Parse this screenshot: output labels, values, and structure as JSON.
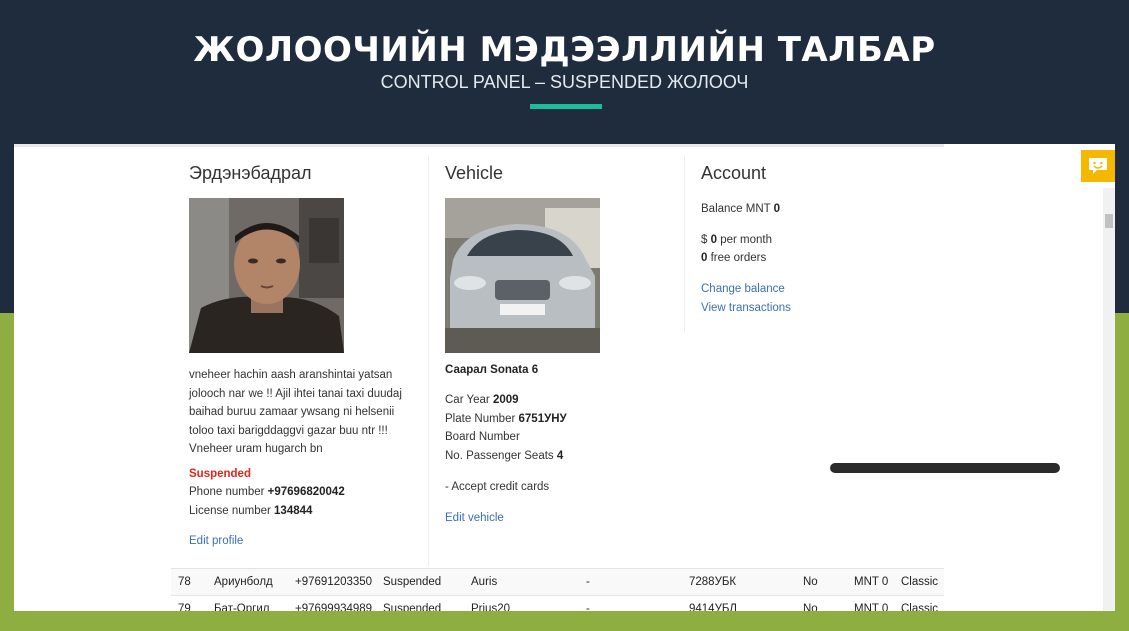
{
  "hero": {
    "title": "ЖОЛООЧИЙН МЭДЭЭЛЛИЙН ТАЛБАР",
    "subtitle": "CONTROL PANEL – SUSPENDED ЖОЛООЧ",
    "accent_color": "#1abc9c"
  },
  "driver": {
    "name": "Эрдэнэбадрал",
    "bio_lines": [
      "vneheer hachin aash aranshintai yatsan",
      "jolooch nar we !! Ajil ihtei tanai taxi duudaj",
      "baihad buruu zamaar ywsang ni helsenii",
      "toloo taxi barigddaggvi gazar buu ntr !!!",
      "Vneheer uram hugarch bn"
    ],
    "status": "Suspended",
    "phone_label": "Phone number",
    "phone": "+97696820042",
    "license_label": "License number",
    "license": "134844",
    "edit_link": "Edit profile"
  },
  "vehicle": {
    "heading": "Vehicle",
    "name": "Саарал Sonata 6",
    "year_label": "Car Year",
    "year": "2009",
    "plate_label": "Plate Number",
    "plate": "6751УНУ",
    "board_label": "Board Number",
    "seats_label": "No. Passenger Seats",
    "seats": "4",
    "credit": "- Accept credit cards",
    "plate_on_car": "6751 УНУ",
    "edit_link": "Edit vehicle"
  },
  "account": {
    "heading": "Account",
    "balance_label": "Balance MNT",
    "balance": "0",
    "rate_prefix": "$",
    "rate": "0",
    "rate_suffix": "per month",
    "free_orders": "0",
    "free_label": "free orders",
    "change_balance": "Change balance",
    "view_transactions": "View transactions"
  },
  "table_rows": [
    {
      "id": "78",
      "name": "Ариунболд",
      "phone": "+97691203350",
      "status": "Suspended",
      "model": "Auris",
      "dash": "-",
      "plate": "7288УБК",
      "credit": "No",
      "balance": "MNT 0",
      "class": "Classic"
    },
    {
      "id": "79",
      "name": "Бат-Оргил",
      "phone": "+97699934989",
      "status": "Suspended",
      "model": "Prius20",
      "dash": "-",
      "plate": "9414УБЛ",
      "credit": "No",
      "balance": "MNT 0",
      "class": "Classic"
    }
  ]
}
